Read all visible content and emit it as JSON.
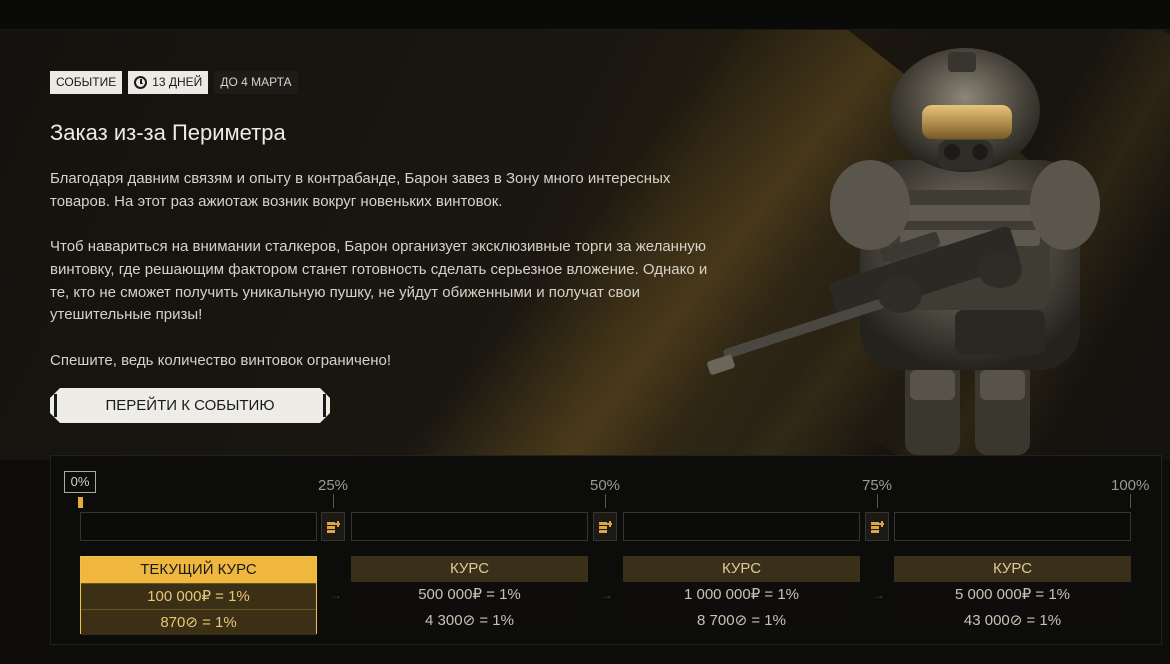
{
  "event": {
    "tag_event": "СОБЫТИЕ",
    "tag_days": "13 ДНЕЙ",
    "tag_until": "ДО 4 МАРТА",
    "title": "Заказ из-за Периметра",
    "paragraphs": [
      "Благодаря давним связям и опыту в контрабанде, Барон завез в Зону много интересных товаров. На этот раз ажиотаж возник вокруг новеньких винтовок.",
      "Чтоб навариться на внимании сталкеров, Барон организует эксклюзивные торги за желанную винтовку, где решающим фактором станет готовность сделать серьезное вложение. Однако и те, кто не сможет получить уникальную пушку, не уйдут обиженными и получат свои утешительные призы!",
      "Спешите, ведь количество винтовок ограничено!"
    ],
    "cta_label": "ПЕРЕЙТИ К СОБЫТИЮ",
    "icons": {
      "clock": "clock-icon",
      "soldier": "soldier-illustration",
      "stack": "coin-stack-icon"
    }
  },
  "progress": {
    "current_percent": 0,
    "labels": [
      "0%",
      "25%",
      "50%",
      "75%",
      "100%"
    ]
  },
  "rates": [
    {
      "head": "ТЕКУЩИЙ КУРС",
      "row1": "100 000₽ = 1%",
      "row2": "870⊘ = 1%",
      "active": true
    },
    {
      "head": "КУРС",
      "row1": "500 000₽ = 1%",
      "row2": "4 300⊘ = 1%",
      "active": false
    },
    {
      "head": "КУРС",
      "row1": "1 000 000₽ = 1%",
      "row2": "8 700⊘ = 1%",
      "active": false
    },
    {
      "head": "КУРС",
      "row1": "5 000 000₽ = 1%",
      "row2": "43 000⊘ = 1%",
      "active": false
    }
  ],
  "colors": {
    "accent": "#efb73e",
    "inactive_head": "#3a2f18",
    "background": "#0e0d0b"
  }
}
